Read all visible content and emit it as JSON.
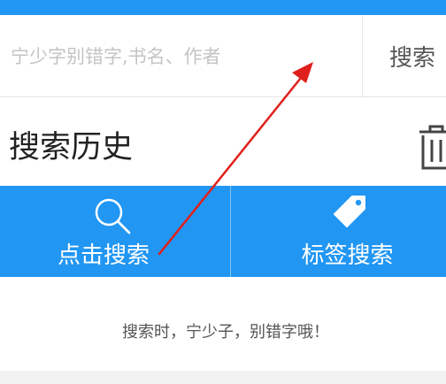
{
  "search": {
    "placeholder": "宁少字别错字,书名、作者",
    "button_label": "搜索"
  },
  "history": {
    "title": "搜索历史",
    "clear_icon": "trash-icon"
  },
  "actions": [
    {
      "label": "点击搜索",
      "icon": "search-icon"
    },
    {
      "label": "标签搜索",
      "icon": "tag-icon"
    }
  ],
  "hint": "搜索时，宁少子，别错字哦！",
  "colors": {
    "accent": "#2196f3",
    "annotation_arrow": "#e0201c"
  }
}
